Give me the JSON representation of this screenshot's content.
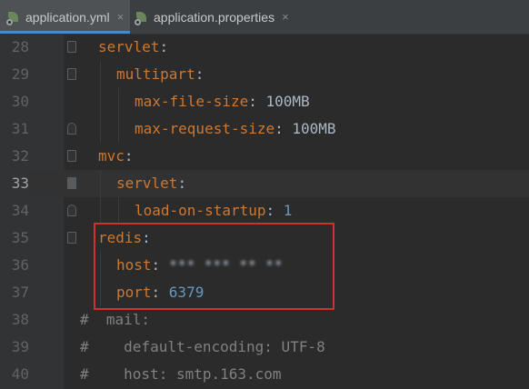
{
  "tabs": [
    {
      "label": "application.yml",
      "active": true,
      "icon": "spring-leaf-icon"
    },
    {
      "label": "application.properties",
      "active": false,
      "icon": "spring-leaf-icon"
    }
  ],
  "close_glyph": "×",
  "lines": [
    {
      "num": "28",
      "key": "servlet",
      "sep": ":",
      "value": ""
    },
    {
      "num": "29",
      "key": "multipart",
      "sep": ":",
      "value": ""
    },
    {
      "num": "30",
      "key": "max-file-size",
      "sep": ": ",
      "value": "100MB"
    },
    {
      "num": "31",
      "key": "max-request-size",
      "sep": ": ",
      "value": "100MB"
    },
    {
      "num": "32",
      "key": "mvc",
      "sep": ":",
      "value": ""
    },
    {
      "num": "33",
      "key": "servlet",
      "sep": ":",
      "value": ""
    },
    {
      "num": "34",
      "key": "load-on-startup",
      "sep": ": ",
      "value": "1"
    },
    {
      "num": "35",
      "key": "redis",
      "sep": ":",
      "value": ""
    },
    {
      "num": "36",
      "key": "host",
      "sep": ": ",
      "value": "*** *** ** **"
    },
    {
      "num": "37",
      "key": "port",
      "sep": ": ",
      "value": "6379"
    },
    {
      "num": "38",
      "comment": "#  mail:"
    },
    {
      "num": "39",
      "comment": "#    default-encoding: UTF-8"
    },
    {
      "num": "40",
      "comment": "#    host: smtp.163.com"
    }
  ],
  "colors": {
    "background": "#2b2b2b",
    "gutter": "#313335",
    "key": "#cc7832",
    "number": "#6897bb",
    "comment": "#808080",
    "highlight_box": "#d42f2f"
  }
}
